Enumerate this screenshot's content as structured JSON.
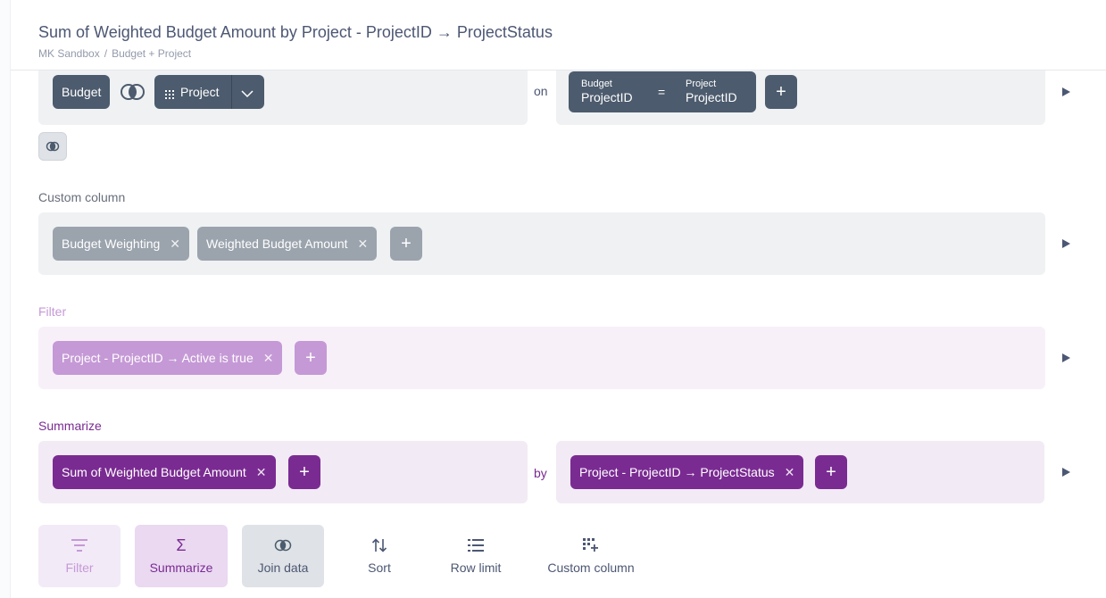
{
  "header": {
    "title": "Sum of Weighted Budget Amount by Project - ProjectID → ProjectStatus",
    "breadcrumb": [
      "MK Sandbox",
      "Budget + Project"
    ],
    "breadcrumb_sep": "/"
  },
  "join": {
    "left_table": "Budget",
    "right_table": "Project",
    "on_label": "on",
    "condition": {
      "left_table": "Budget",
      "left_field": "ProjectID",
      "operator": "=",
      "right_table": "Project",
      "right_field": "ProjectID"
    },
    "join_type_icon": "join-venn-icon"
  },
  "custom_column": {
    "label": "Custom column",
    "items": [
      "Budget Weighting",
      "Weighted Budget Amount"
    ]
  },
  "filter": {
    "label": "Filter",
    "items": [
      "Project - ProjectID → Active is true"
    ]
  },
  "summarize": {
    "label": "Summarize",
    "metrics": [
      "Sum of Weighted Budget Amount"
    ],
    "by_label": "by",
    "breakouts": [
      "Project - ProjectID → ProjectStatus"
    ]
  },
  "actions": [
    {
      "label": "Filter",
      "icon": "filter-icon"
    },
    {
      "label": "Summarize",
      "icon": "sigma-icon"
    },
    {
      "label": "Join data",
      "icon": "join-icon"
    },
    {
      "label": "Sort",
      "icon": "sort-icon"
    },
    {
      "label": "Row limit",
      "icon": "list-icon"
    },
    {
      "label": "Custom column",
      "icon": "add-grid-icon"
    }
  ],
  "colors": {
    "dark_pill": "#4c5b6d",
    "gray_pill": "#9ba3ad",
    "filter_pill": "#c599d6",
    "summarize_pill": "#7a2b92",
    "text": "#4c5773"
  },
  "glyphs": {
    "plus": "+",
    "remove": "✕"
  }
}
